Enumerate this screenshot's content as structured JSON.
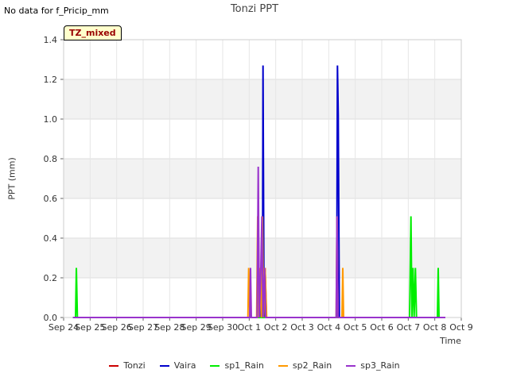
{
  "nodata_text": "No data for f_Pricip_mm",
  "badge_text": "TZ_mixed",
  "chart_data": {
    "type": "line",
    "title": "Tonzi PPT",
    "xlabel": "Time",
    "ylabel": "PPT (mm)",
    "ylim": [
      0,
      1.4
    ],
    "xlim": [
      0,
      15
    ],
    "xticks": [
      "Sep 24",
      "Sep 25",
      "Sep 26",
      "Sep 27",
      "Sep 28",
      "Sep 29",
      "Sep 30",
      "Oct 1",
      "Oct 2",
      "Oct 3",
      "Oct 4",
      "Oct 5",
      "Oct 6",
      "Oct 7",
      "Oct 8",
      "Oct 9"
    ],
    "yticks": [
      "0.0",
      "0.2",
      "0.4",
      "0.6",
      "0.8",
      "1.0",
      "1.2",
      "1.4"
    ],
    "grid": true,
    "legend_position": "bottom",
    "series": [
      {
        "name": "Tonzi",
        "color": "#cc0000",
        "points": [
          [
            7.0,
            0
          ],
          [
            7.55,
            0
          ],
          [
            7.6,
            0.25
          ],
          [
            7.65,
            0
          ],
          [
            14.4,
            0
          ]
        ]
      },
      {
        "name": "Vaira",
        "color": "#0000cc",
        "points": [
          [
            7.0,
            0
          ],
          [
            7.4,
            0
          ],
          [
            7.45,
            0.25
          ],
          [
            7.5,
            0
          ],
          [
            7.52,
            1.27
          ],
          [
            7.56,
            0
          ],
          [
            10.3,
            0
          ],
          [
            10.33,
            1.27
          ],
          [
            10.36,
            1.02
          ],
          [
            10.4,
            0
          ],
          [
            14.4,
            0
          ]
        ]
      },
      {
        "name": "sp1_Rain",
        "color": "#00ee00",
        "points": [
          [
            0.35,
            0
          ],
          [
            0.45,
            0
          ],
          [
            0.48,
            0.25
          ],
          [
            0.52,
            0
          ],
          [
            13.05,
            0
          ],
          [
            13.1,
            0.51
          ],
          [
            13.14,
            0
          ],
          [
            13.18,
            0.25
          ],
          [
            13.22,
            0
          ],
          [
            13.27,
            0.25
          ],
          [
            13.31,
            0
          ],
          [
            14.1,
            0
          ],
          [
            14.13,
            0.25
          ],
          [
            14.16,
            0
          ],
          [
            14.4,
            0
          ]
        ]
      },
      {
        "name": "sp2_Rain",
        "color": "#ff9900",
        "points": [
          [
            6.95,
            0
          ],
          [
            6.98,
            0.25
          ],
          [
            7.03,
            0
          ],
          [
            7.28,
            0
          ],
          [
            7.32,
            0.51
          ],
          [
            7.36,
            0
          ],
          [
            7.42,
            0.25
          ],
          [
            7.46,
            0
          ],
          [
            7.5,
            0.51
          ],
          [
            7.54,
            0
          ],
          [
            7.6,
            0.25
          ],
          [
            7.66,
            0
          ],
          [
            10.28,
            0
          ],
          [
            10.31,
            0.51
          ],
          [
            10.35,
            0
          ],
          [
            10.5,
            0
          ],
          [
            10.53,
            0.25
          ],
          [
            10.56,
            0
          ],
          [
            14.4,
            0
          ]
        ]
      },
      {
        "name": "sp3_Rain",
        "color": "#9933cc",
        "points": [
          [
            0.35,
            0
          ],
          [
            7.02,
            0
          ],
          [
            7.05,
            0.25
          ],
          [
            7.08,
            0
          ],
          [
            7.3,
            0
          ],
          [
            7.34,
            0.76
          ],
          [
            7.38,
            0
          ],
          [
            7.44,
            0.25
          ],
          [
            7.48,
            0.51
          ],
          [
            7.52,
            0
          ],
          [
            7.58,
            0.25
          ],
          [
            7.62,
            0
          ],
          [
            10.28,
            0
          ],
          [
            10.31,
            0.51
          ],
          [
            10.35,
            0
          ],
          [
            14.4,
            0
          ]
        ]
      }
    ]
  }
}
